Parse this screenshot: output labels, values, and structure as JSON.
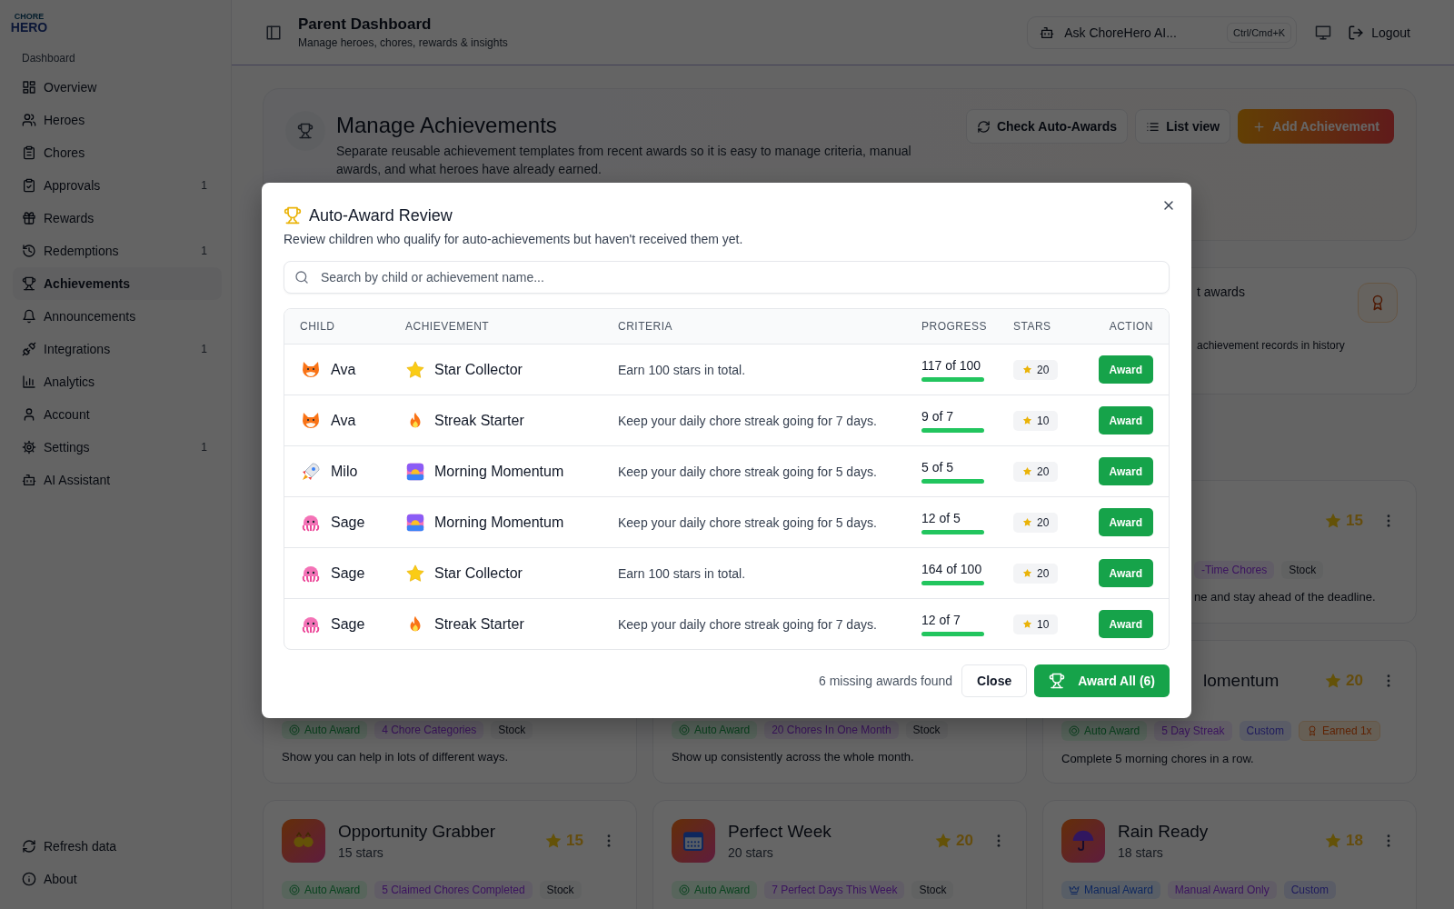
{
  "logo": {
    "line1": "CHORE",
    "line2": "HERO"
  },
  "sidebar": {
    "section_label": "Dashboard",
    "items": [
      {
        "label": "Overview",
        "selected": false
      },
      {
        "label": "Heroes",
        "selected": false
      },
      {
        "label": "Chores",
        "selected": false
      },
      {
        "label": "Approvals",
        "badge": "1",
        "selected": false
      },
      {
        "label": "Rewards",
        "selected": false
      },
      {
        "label": "Redemptions",
        "badge": "1",
        "selected": false
      },
      {
        "label": "Achievements",
        "selected": true
      },
      {
        "label": "Announcements",
        "selected": false
      },
      {
        "label": "Integrations",
        "badge": "1",
        "selected": false
      },
      {
        "label": "Analytics",
        "selected": false
      },
      {
        "label": "Account",
        "selected": false
      },
      {
        "label": "Settings",
        "badge": "1",
        "selected": false
      },
      {
        "label": "AI Assistant",
        "selected": false
      }
    ],
    "footer_items": [
      {
        "label": "Refresh data"
      },
      {
        "label": "About"
      }
    ]
  },
  "header": {
    "title": "Parent Dashboard",
    "subtitle": "Manage heroes, chores, rewards & insights",
    "ai_search": {
      "placeholder": "Ask ChoreHero AI...",
      "shortcut": "Ctrl/Cmd+K"
    },
    "logout": "Logout"
  },
  "page_header": {
    "title": "Manage Achievements",
    "description": "Separate reusable achievement templates from recent awards so it is easy to manage criteria, manual awards, and what heroes have already earned.",
    "buttons": [
      {
        "label": "Check Auto-Awards",
        "kind": "check"
      },
      {
        "label": "List view",
        "kind": "view"
      },
      {
        "label": "Add Achievement",
        "kind": "primary"
      }
    ]
  },
  "summary_card": {
    "title": "t awards",
    "description": "achievement records in history"
  },
  "achievement_cards": [
    {
      "star_count": "15",
      "tags": [
        {
          "label": "-Time Chores",
          "kind": "criteria"
        },
        {
          "label": "Stock",
          "kind": "stock"
        }
      ],
      "description": "ne and stay ahead of the deadline."
    },
    {
      "tags": [
        {
          "label": "Auto Award",
          "kind": "auto"
        },
        {
          "label": "4 Chore Categories",
          "kind": "criteria"
        },
        {
          "label": "Stock",
          "kind": "stock"
        }
      ],
      "description": "Show you can help in lots of different ways."
    },
    {
      "tags": [
        {
          "label": "Auto Award",
          "kind": "auto"
        },
        {
          "label": "20 Chores In One Month",
          "kind": "criteria"
        },
        {
          "label": "Stock",
          "kind": "stock"
        }
      ],
      "description": "Show up consistently across the whole month."
    },
    {
      "title": "lomentum",
      "star_count": "20",
      "tags": [
        {
          "label": "Auto Award",
          "kind": "auto"
        },
        {
          "label": "5 Day Streak",
          "kind": "criteria"
        },
        {
          "label": "Custom",
          "kind": "custom"
        },
        {
          "label": "Earned 1x",
          "kind": "earned"
        }
      ],
      "description": "Complete 5 morning chores in a row."
    },
    {
      "title": "Opportunity Grabber",
      "subtitle": "15 stars",
      "star_count": "15",
      "tags": [
        {
          "label": "Auto Award",
          "kind": "auto"
        },
        {
          "label": "5 Claimed Chores Completed",
          "kind": "criteria"
        },
        {
          "label": "Stock",
          "kind": "stock"
        }
      ]
    },
    {
      "title": "Perfect Week",
      "subtitle": "20 stars",
      "star_count": "20",
      "tags": [
        {
          "label": "Auto Award",
          "kind": "auto"
        },
        {
          "label": "7 Perfect Days This Week",
          "kind": "criteria"
        },
        {
          "label": "Stock",
          "kind": "stock"
        }
      ]
    },
    {
      "title": "Rain Ready",
      "subtitle": "18 stars",
      "star_count": "18",
      "tags": [
        {
          "label": "Manual Award",
          "kind": "manual"
        },
        {
          "label": "Manual Award Only",
          "kind": "criteria"
        },
        {
          "label": "Custom",
          "kind": "custom"
        }
      ]
    }
  ],
  "modal": {
    "title": "Auto-Award Review",
    "description": "Review children who qualify for auto-achievements but haven't received them yet.",
    "search": {
      "placeholder": "Search by child or achievement name..."
    },
    "table": {
      "columns": [
        "CHILD",
        "ACHIEVEMENT",
        "CRITERIA",
        "PROGRESS",
        "STARS",
        "ACTION"
      ],
      "rows": [
        {
          "child": "Ava",
          "achievement": "Star Collector",
          "criteria": "Earn 100 stars in total.",
          "progress": "117 of 100",
          "level": 1,
          "reward": "20",
          "action": "Award"
        },
        {
          "child": "Ava",
          "achievement": "Streak Starter",
          "criteria": "Keep your daily chore streak going for 7 days.",
          "progress": "9 of 7",
          "level": 1,
          "reward": "10",
          "action": "Award"
        },
        {
          "child": "Milo",
          "achievement": "Morning Momentum",
          "criteria": "Keep your daily chore streak going for 5 days.",
          "progress": "5 of 5",
          "level": 1,
          "reward": "20",
          "action": "Award"
        },
        {
          "child": "Sage",
          "achievement": "Morning Momentum",
          "criteria": "Keep your daily chore streak going for 5 days.",
          "progress": "12 of 5",
          "level": 1,
          "reward": "20",
          "action": "Award"
        },
        {
          "child": "Sage",
          "achievement": "Star Collector",
          "criteria": "Earn 100 stars in total.",
          "progress": "164 of 100",
          "level": 1,
          "reward": "20",
          "action": "Award"
        },
        {
          "child": "Sage",
          "achievement": "Streak Starter",
          "criteria": "Keep your daily chore streak going for 7 days.",
          "progress": "12 of 7",
          "level": 1,
          "reward": "10",
          "action": "Award"
        }
      ]
    },
    "footer": {
      "summary": "6 missing awards found",
      "buttons": [
        {
          "label": "Close",
          "kind": "secondary"
        },
        {
          "label": "Award All (6)",
          "kind": "primary"
        }
      ]
    }
  }
}
